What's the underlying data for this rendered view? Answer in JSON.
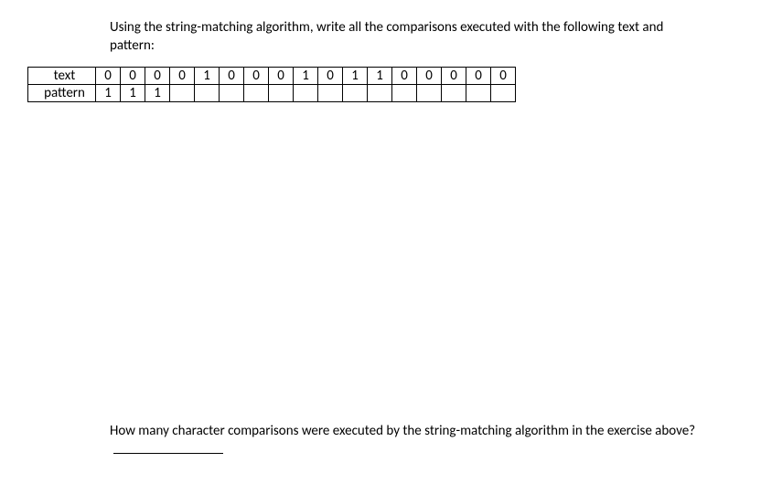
{
  "prompt": "Using the string-matching algorithm, write all the comparisons executed with the following text and pattern:",
  "row_labels": {
    "text": "text",
    "pattern": "pattern"
  },
  "text_row": [
    "0",
    "0",
    "0",
    "0",
    "1",
    "0",
    "0",
    "0",
    "1",
    "0",
    "1",
    "1",
    "0",
    "0",
    "0",
    "0",
    "0"
  ],
  "pattern_row": [
    "1",
    "1",
    "1",
    "",
    "",
    "",
    "",
    "",
    "",
    "",
    "",
    "",
    "",
    "",
    "",
    "",
    ""
  ],
  "question_part1": "How many character comparisons were executed by the string-matching algorithm in the exercise above?"
}
